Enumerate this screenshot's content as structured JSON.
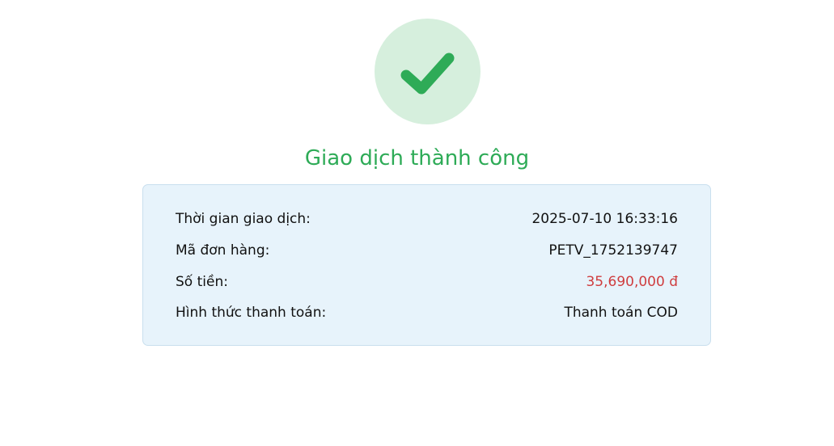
{
  "status": {
    "icon": "check-icon",
    "title": "Giao dịch thành công",
    "colors": {
      "success": "#2eab57",
      "success_bg": "#d6efdd",
      "amount": "#cf3d3f",
      "card_bg": "#e7f3fb"
    }
  },
  "details": {
    "rows": [
      {
        "label": "Thời gian giao dịch:",
        "value": "2025-07-10 16:33:16"
      },
      {
        "label": "Mã đơn hàng:",
        "value": "PETV_1752139747"
      },
      {
        "label": "Số tiền:",
        "value": "35,690,000 đ"
      },
      {
        "label": "Hình thức thanh toán:",
        "value": "Thanh toán COD"
      }
    ]
  }
}
